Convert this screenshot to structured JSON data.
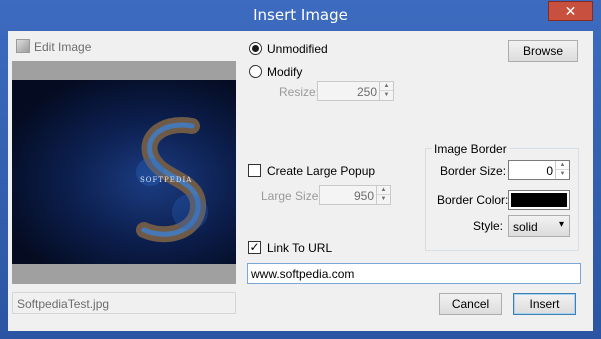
{
  "window": {
    "title": "Insert Image",
    "close_glyph": "✕"
  },
  "left_panel": {
    "edit_image_label": "Edit Image",
    "preview_caption": "SOFTPEDIA",
    "filename": "SoftpediaTest.jpg"
  },
  "options": {
    "unmodified_label": "Unmodified",
    "unmodified_checked": true,
    "modify_label": "Modify",
    "modify_checked": false,
    "resize_label": "Resize:",
    "resize_value": "250",
    "create_popup_label": "Create Large Popup",
    "create_popup_checked": false,
    "large_size_label": "Large Size:",
    "large_size_value": "950",
    "link_url_label": "Link To URL",
    "link_url_checked": true,
    "check_glyph": "✓",
    "url_value": "www.softpedia.com"
  },
  "image_border": {
    "title": "Image Border",
    "border_size_label": "Border Size:",
    "border_size_value": "0",
    "border_color_label": "Border Color:",
    "border_color": "#000000",
    "style_label": "Style:",
    "style_value": "solid"
  },
  "buttons": {
    "browse": "Browse",
    "cancel": "Cancel",
    "insert": "Insert"
  },
  "icons": {
    "edit_image": "image-edit-icon",
    "spin_up": "▲",
    "spin_down": "▼",
    "dropdown": "▾"
  }
}
